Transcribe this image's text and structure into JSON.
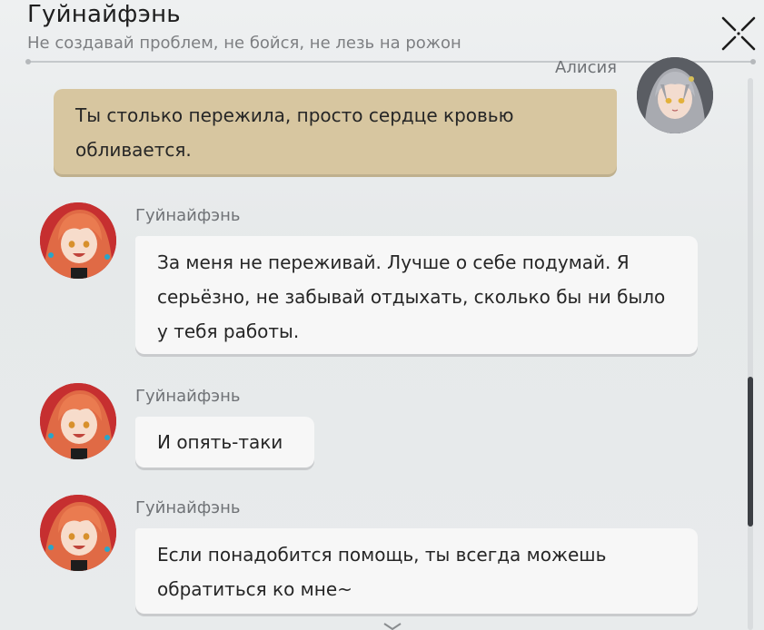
{
  "header": {
    "title": "Гуйнайфэнь",
    "subtitle": "Не создавай проблем, не бойся, не лезь на рожон",
    "close_icon": "close-x-icon"
  },
  "messages": [
    {
      "direction": "outgoing",
      "sender": "Алисия",
      "text": "Ты столько пережила, просто сердце кровью обливается."
    },
    {
      "direction": "incoming",
      "sender": "Гуйнайфэнь",
      "text": "За меня не переживай. Лучше о себе подумай. Я серьёзно, не забывай отдыхать, сколько бы ни было у тебя работы."
    },
    {
      "direction": "incoming",
      "sender": "Гуйнайфэнь",
      "text": "И опять-таки"
    },
    {
      "direction": "incoming",
      "sender": "Гуйнайфэнь",
      "text": "Если понадобится помощь, ты всегда можешь обратиться ко мне~"
    }
  ],
  "colors": {
    "outgoing_bubble": "#d7c6a0",
    "incoming_bubble": "#f7f7f7",
    "scroll_thumb": "#3c3f44"
  }
}
